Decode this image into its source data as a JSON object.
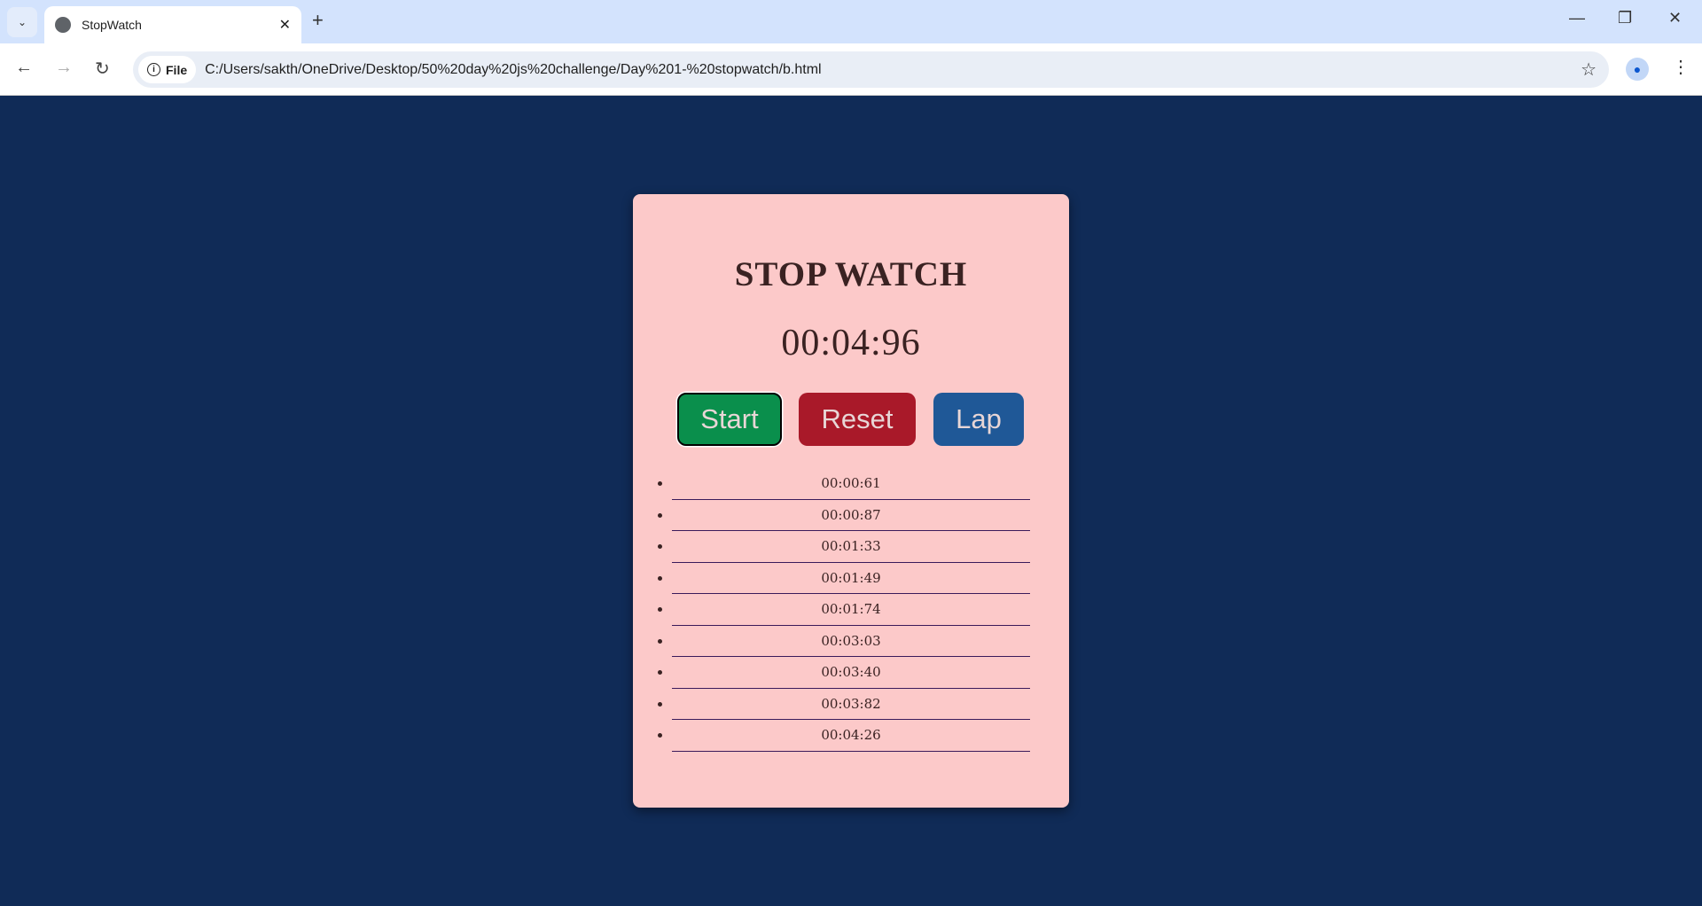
{
  "browser": {
    "tab_title": "StopWatch",
    "chip_label": "File",
    "url": "C:/Users/sakth/OneDrive/Desktop/50%20day%20js%20challenge/Day%201-%20stopwatch/b.html"
  },
  "app": {
    "title": "STOP WATCH",
    "time": "00:04:96",
    "buttons": {
      "start": "Start",
      "reset": "Reset",
      "lap": "Lap"
    },
    "laps": [
      "00:00:61",
      "00:00:87",
      "00:01:33",
      "00:01:49",
      "00:01:74",
      "00:03:03",
      "00:03:40",
      "00:03:82",
      "00:04:26"
    ]
  },
  "colors": {
    "background": "#102b57",
    "card": "#fcc9c9",
    "start": "#0a8f4c",
    "reset": "#a91929",
    "lap": "#1f5897"
  }
}
